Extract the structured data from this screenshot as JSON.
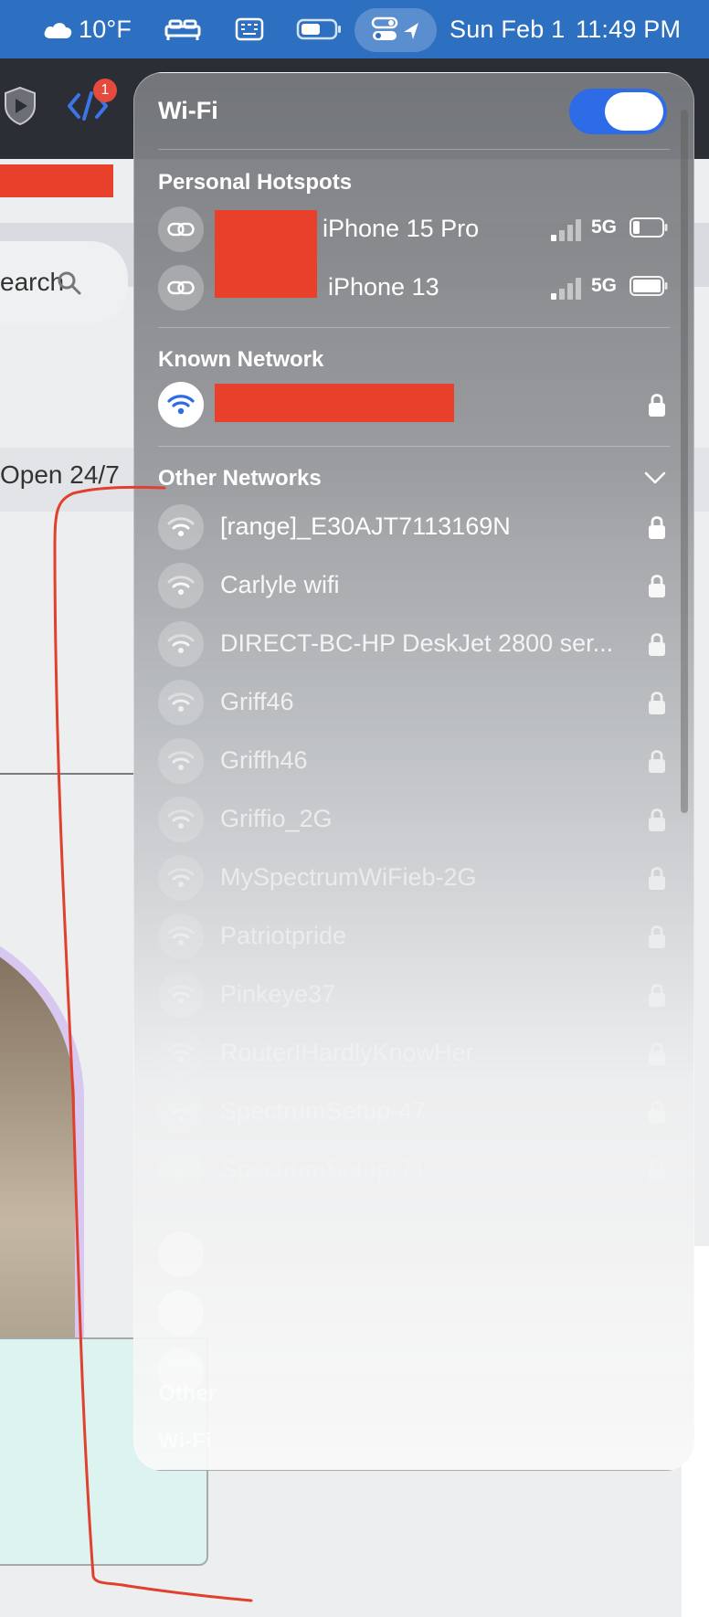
{
  "menubar": {
    "weather": "10°F",
    "date": "Sun Feb 1",
    "time": "11:49 PM"
  },
  "background": {
    "search_text": "earch",
    "open_text": "Open 24/7",
    "notification_count": "1"
  },
  "wifi_panel": {
    "title": "Wi-Fi",
    "toggle_on": true,
    "sections": {
      "hotspots": "Personal Hotspots",
      "known": "Known Network",
      "other": "Other Networks"
    },
    "hotspots": [
      {
        "name": "iPhone 15 Pro",
        "signal": "5G",
        "battery": 0.2
      },
      {
        "name": "iPhone 13",
        "signal": "5G",
        "battery": 0.85
      }
    ],
    "other_networks": [
      {
        "name": "[range]_E30AJT7113169N"
      },
      {
        "name": "Carlyle wifi"
      },
      {
        "name": "DIRECT-BC-HP DeskJet 2800 ser..."
      },
      {
        "name": "Griff46"
      },
      {
        "name": "Griffh46"
      },
      {
        "name": "Griffio_2G"
      },
      {
        "name": "MySpectrumWiFieb-2G"
      },
      {
        "name": "Patriotpride"
      },
      {
        "name": "Pinkeye37"
      },
      {
        "name": "RouterIHardlyKnowHer"
      },
      {
        "name": "SpectrumSetup-47"
      },
      {
        "name": "SpectrumSetup-71"
      }
    ],
    "footer": {
      "other": "Other",
      "settings": "Wi-Fi"
    }
  },
  "colors": {
    "accent": "#2e6be6",
    "menubar": "#2d6fc0",
    "redaction": "#e8402b"
  }
}
